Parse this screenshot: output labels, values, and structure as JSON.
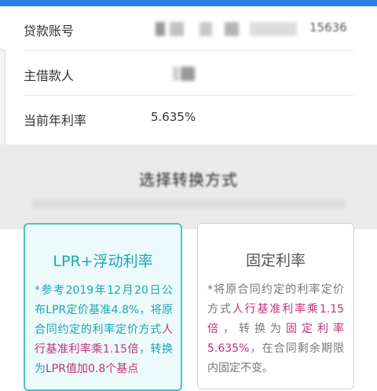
{
  "loan_info": {
    "account_label": "贷款账号",
    "account_value_suffix": "15636",
    "borrower_label": "主借款人",
    "rate_label": "当前年利率",
    "rate_value": "5.635%"
  },
  "overlay": {
    "text": "选择转换方式"
  },
  "options": {
    "lpr": {
      "title": "LPR+浮动利率",
      "desc_1": "*参考2019年12月20日公布LPR定价基准4.8%，将原合同约定的利率定价方式",
      "desc_2": "人行基准利率乘1.15倍",
      "desc_3": "，转换为",
      "desc_4": "LPR值加0.8个基点"
    },
    "fixed": {
      "title": "固定利率",
      "desc_1": "*将原合同约定的利率定价方式",
      "desc_2": "人行基准利率乘1.15倍",
      "desc_3": "，转换为",
      "desc_4": "固定利率5.635%",
      "desc_5": "，在合同剩余期限内固定不变。"
    }
  },
  "colors": {
    "accent": "#2f7ee6",
    "teal": "#1aa6b7",
    "highlight": "#c0337a"
  }
}
